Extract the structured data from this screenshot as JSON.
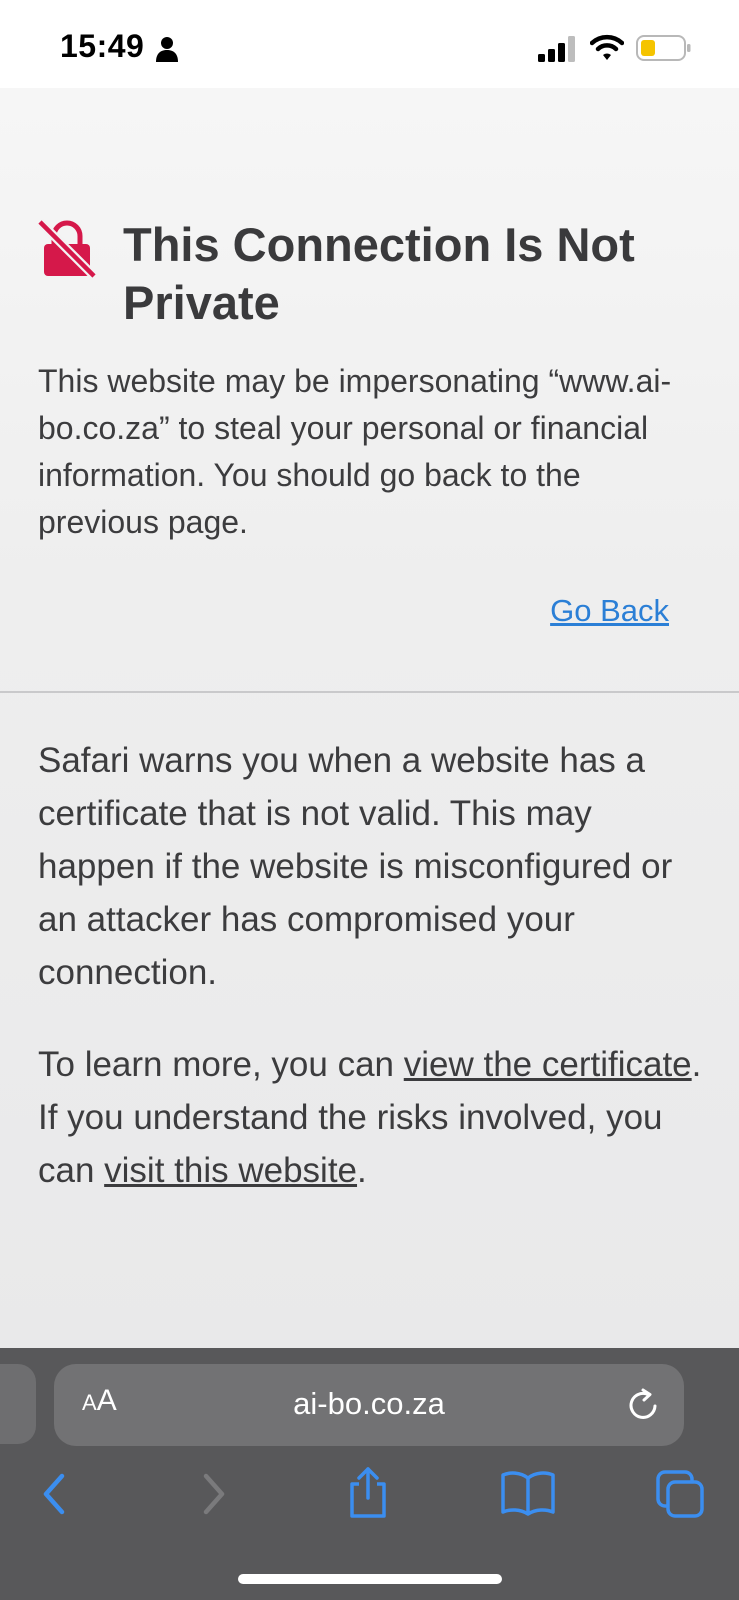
{
  "status_bar": {
    "time": "15:49",
    "icons": [
      "person-icon",
      "cellular-signal-icon",
      "wifi-icon",
      "battery-icon"
    ],
    "battery_color": "#f5c400"
  },
  "warning_page": {
    "icon": "lock-slash-icon",
    "icon_color": "#d5184a",
    "title": "This Connection Is Not Private",
    "intro": "This website may be impersonating “www.ai-bo.co.za” to steal your personal or financial information. You should go back to the previous page.",
    "go_back_label": "Go Back",
    "link_color": "#2b7fd6",
    "details": "Safari warns you when a website has a certificate that is not valid. This may happen if the website is misconfigured or an attacker has compromised your connection.",
    "learn_more": {
      "prefix": "To learn more, you can ",
      "view_certificate_link": "view the certificate",
      "middle": ". If you understand the risks involved, you can ",
      "visit_website_link": "visit this website",
      "suffix": "."
    }
  },
  "address_bar": {
    "aa_small": "A",
    "aa_big": "A",
    "url": "ai-bo.co.za",
    "reload_icon": "reload-icon"
  },
  "toolbar": {
    "icons": [
      "back-icon",
      "forward-icon",
      "share-icon",
      "bookmarks-icon",
      "tabs-icon"
    ],
    "accent_color": "#3b8ef0"
  }
}
